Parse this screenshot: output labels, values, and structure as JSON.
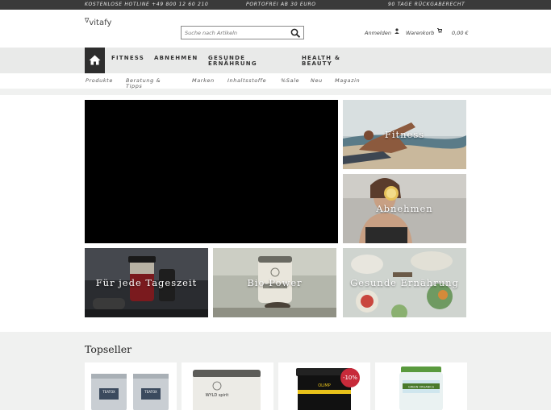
{
  "topbar": {
    "hotline": "KOSTENLOSE HOTLINE +49 800 12 60 210",
    "shipping": "PORTOFREI AB 30 EURO",
    "returns": "90 TAGE RÜCKGABERECHT"
  },
  "header": {
    "logo": "vitafy",
    "search_placeholder": "Suche nach Artikeln",
    "login": "Anmelden",
    "cart": "Warenkorb",
    "cart_total": "0,00 €"
  },
  "nav": {
    "items": [
      "FITNESS",
      "ABNEHMEN",
      "GESUNDE ERNÄHRUNG",
      "HEALTH & BEAUTY"
    ]
  },
  "subnav": {
    "items": [
      "Produkte",
      "Beratung & Tipps",
      "Marken",
      "Inhaltsstoffe",
      "%Sale",
      "Neu",
      "Magazin"
    ]
  },
  "tiles": {
    "fitness": "Fitness",
    "abnehmen": "Abnehmen",
    "tageszeit": "Für jede Tageszeit",
    "bio": "Bio-Power",
    "ernaehrung": "Gesunde Ernährung"
  },
  "topseller": {
    "title": "Topseller",
    "badge": "-10%",
    "products": [
      "TEATOX",
      "WYLD spirit",
      "OLIMP",
      "GREEN ORGANICS"
    ]
  },
  "colors": {
    "topbar": "#3a3a3a",
    "nav": "#e9eae9",
    "badge": "#c72a3a"
  }
}
